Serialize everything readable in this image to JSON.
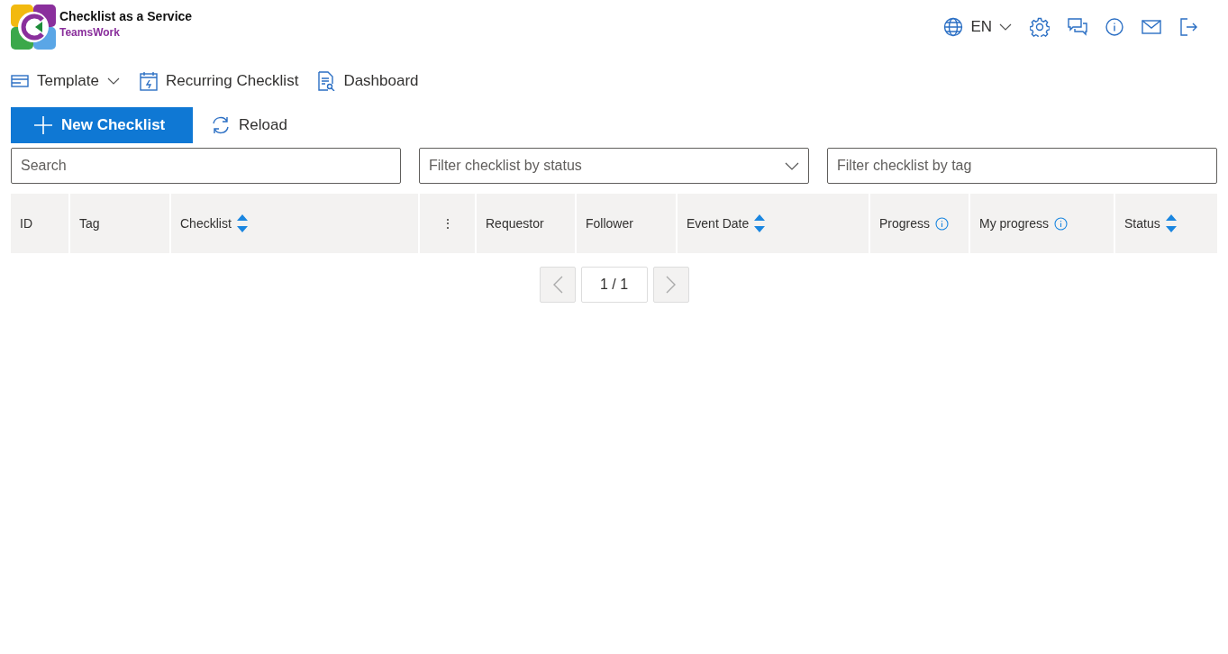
{
  "app": {
    "title": "Checklist as a Service",
    "subtitle": "TeamsWork"
  },
  "header": {
    "language": "EN"
  },
  "nav": [
    {
      "label": "Template",
      "kind": "dropdown"
    },
    {
      "label": "Recurring Checklist",
      "kind": "calendar"
    },
    {
      "label": "Dashboard",
      "kind": "report"
    }
  ],
  "actions": {
    "new_button": "New Checklist",
    "reload": "Reload"
  },
  "filters": {
    "search": {
      "placeholder": "Search"
    },
    "status": {
      "placeholder": "Filter checklist by status"
    },
    "tag": {
      "placeholder": "Filter checklist by tag"
    }
  },
  "table": {
    "columns": [
      {
        "label": "ID",
        "kind": "text"
      },
      {
        "label": "Tag",
        "kind": "text"
      },
      {
        "label": "Checklist",
        "kind": "sort"
      },
      {
        "label": "⋮",
        "kind": "menu"
      },
      {
        "label": "Requestor",
        "kind": "text"
      },
      {
        "label": "Follower",
        "kind": "text"
      },
      {
        "label": "Event Date",
        "kind": "sort"
      },
      {
        "label": "Progress",
        "kind": "info"
      },
      {
        "label": "My progress",
        "kind": "info"
      },
      {
        "label": "Status",
        "kind": "sort"
      }
    ]
  },
  "pagination": {
    "page": "1 / 1",
    "prev_disabled": true,
    "next_disabled": true
  }
}
